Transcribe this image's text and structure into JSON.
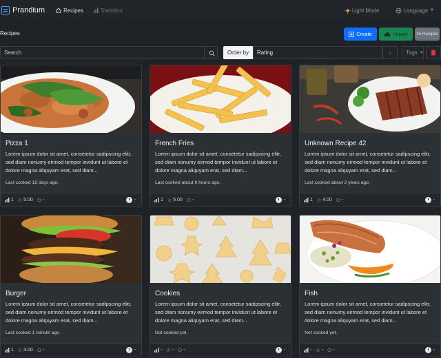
{
  "nav": {
    "brand": "Prandium",
    "recipes": "Recipes",
    "statistics": "Statistics",
    "light_mode": "Light Mode",
    "language": "Language"
  },
  "toolbar": {
    "title": "Recipes",
    "create": "Create",
    "import": "Import",
    "count": "15 Recipes"
  },
  "search": {
    "placeholder": "Search",
    "order_by": "Order by",
    "order_value": "Rating",
    "tags": "Tags"
  },
  "recipes": [
    {
      "title": "Pizza 1",
      "desc": "Lorem ipsum dolor sit amet, consetetur sadipscing elitr, sed diam nonumy eirmod tempor invidunt ut labore et dolore magna aliquyam erat, sed diam...",
      "cooked": "Last cooked 15 days ago.",
      "times": "1",
      "rating": "5.00",
      "people": "-",
      "time": "-"
    },
    {
      "title": "French Fries",
      "desc": "Lorem ipsum dolor sit amet, consetetur sadipscing elitr, sed diam nonumy eirmod tempor invidunt ut labore et dolore magna aliquyam erat, sed diam...",
      "cooked": "Last cooked about 9 hours ago.",
      "times": "1",
      "rating": "5.00",
      "people": "-",
      "time": "-"
    },
    {
      "title": "Unknown Recipe 42",
      "desc": "Lorem ipsum dolor sit amet, consetetur sadipscing elitr, sed diam nonumy eirmod tempor invidunt ut labore et dolore magna aliquyam erat, sed diam...",
      "cooked": "Last cooked about 2 years ago.",
      "times": "1",
      "rating": "4.00",
      "people": "-",
      "time": "-"
    },
    {
      "title": "Burger",
      "desc": "Lorem ipsum dolor sit amet, consetetur sadipscing elitr, sed diam nonumy eirmod tempor invidunt ut labore et dolore magna aliquyam erat, sed diam...",
      "cooked": "Last cooked 1 minute ago.",
      "times": "1",
      "rating": "3.00",
      "people": "-",
      "time": "-"
    },
    {
      "title": "Cookies",
      "desc": "Lorem ipsum dolor sit amet, consetetur sadipscing elitr, sed diam nonumy eirmod tempor invidunt ut labore et dolore magna aliquyam erat, sed diam...",
      "cooked": "Not cooked yet.",
      "times": "-",
      "rating": "-",
      "people": "-",
      "time": "-"
    },
    {
      "title": "Fish",
      "desc": "Lorem ipsum dolor sit amet, consetetur sadipscing elitr, sed diam nonumy eirmod tempor invidunt ut labore et dolore magna aliquyam erat, sed diam...",
      "cooked": "Not cooked yet.",
      "times": "-",
      "rating": "-",
      "people": "-",
      "time": "-"
    }
  ],
  "colors": {
    "primary": "#0d6efd",
    "success": "#198754",
    "secondary": "#6c757d",
    "danger": "#dc3545",
    "background": "#1f2226"
  }
}
